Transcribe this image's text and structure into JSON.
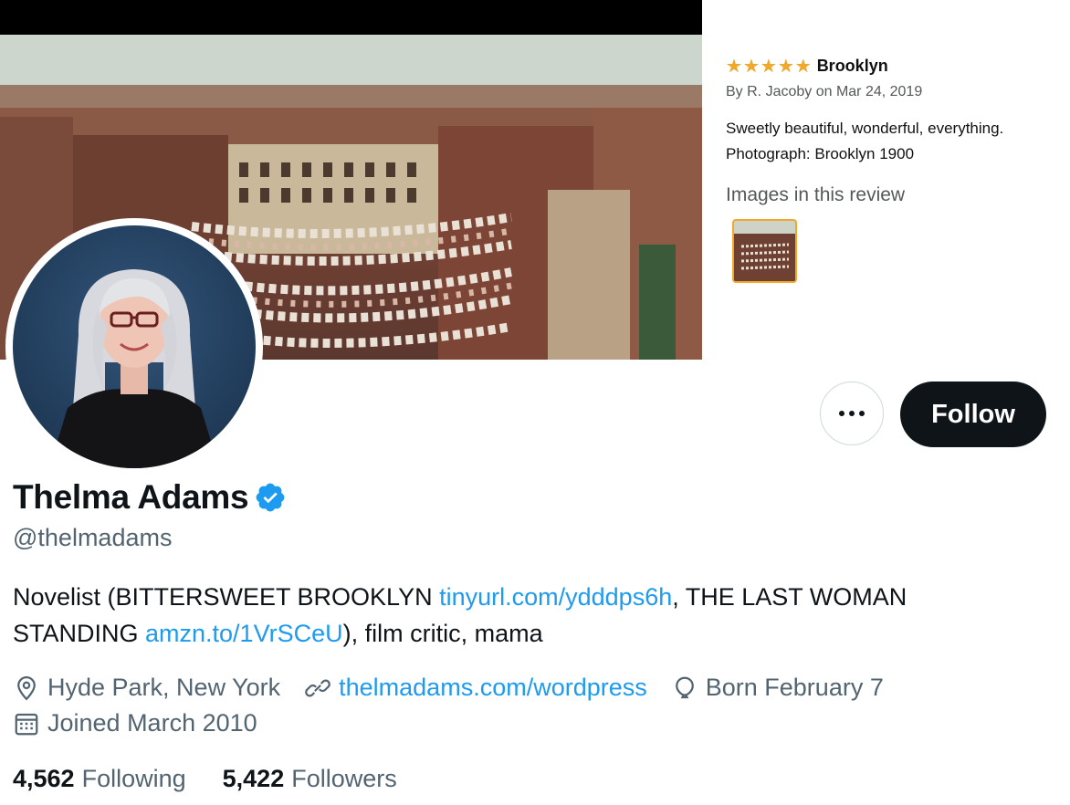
{
  "review": {
    "stars": 5,
    "title": "Brooklyn",
    "byline": "By R. Jacoby on Mar 24, 2019",
    "body_line1": "Sweetly beautiful, wonderful, everything.",
    "body_line2": "Photograph: Brooklyn 1900",
    "images_label": "Images in this review",
    "star_color": "#f0a92a"
  },
  "profile": {
    "display_name": "Thelma Adams",
    "handle": "@thelmadams",
    "verified": true,
    "bio": {
      "part1": "Novelist (BITTERSWEET BROOKLYN ",
      "link1": "tinyurl.com/ydddps6h",
      "part2": ", THE LAST WOMAN STANDING ",
      "link2": "amzn.to/1VrSCeU",
      "part3": "), film critic, mama"
    },
    "location": "Hyde Park, New York",
    "website": "thelmadams.com/wordpress",
    "birthday": "Born February 7",
    "joined": "Joined March 2010",
    "following_count": "4,562",
    "following_label": "Following",
    "followers_count": "5,422",
    "followers_label": "Followers"
  },
  "actions": {
    "more_icon": "ellipsis-icon",
    "follow_label": "Follow"
  },
  "colors": {
    "link": "#1d9bf0",
    "follow_bg": "#0f1419",
    "muted": "#536471"
  }
}
